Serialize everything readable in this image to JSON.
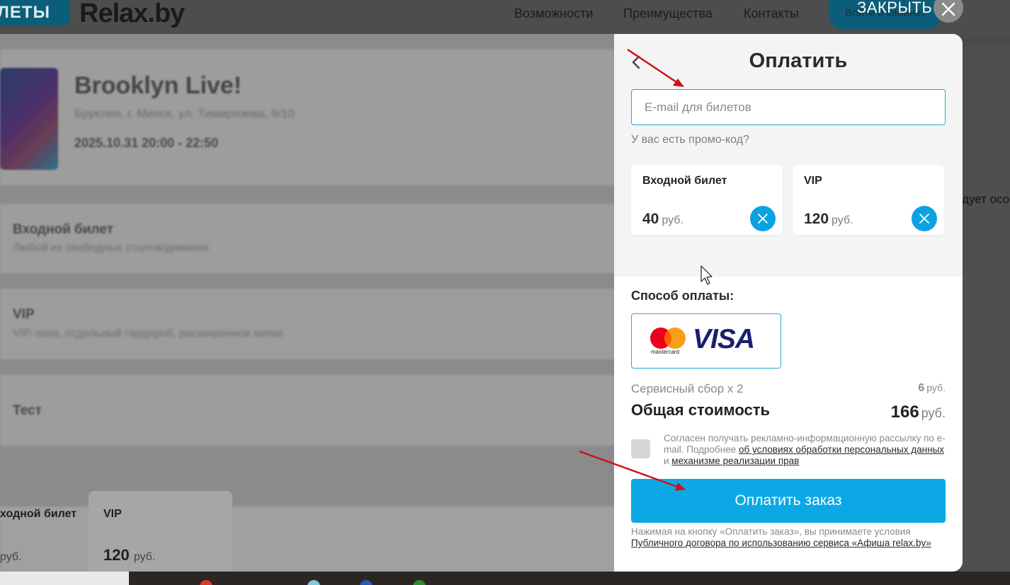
{
  "header": {
    "brand_badge": "ЛЕТЫ",
    "brand_logo": "Relax.by",
    "nav": [
      "Возможности",
      "Преимущества",
      "Контакты"
    ],
    "login_label": "Войти в кабинет",
    "close_label": "ЗАКРЫТЬ"
  },
  "background": {
    "event_title": "Brooklyn Live!",
    "event_address": "Бруклин, г. Минск, ул. Тимирязева, 9/10",
    "event_datetime": "2025.10.31 20:00 - 22:50",
    "rows": [
      {
        "title": "Входной билет",
        "desc": "Любой из свободных столов/диванов"
      },
      {
        "title": "VIP",
        "desc": "VIP-зона, отдельный гардероб, расширенное меню"
      },
      {
        "title": "Тест",
        "desc": ""
      }
    ],
    "bottom_tiles": [
      {
        "name": "ходной билет",
        "price": "",
        "currency": "руб."
      },
      {
        "name": "VIP",
        "price": "120",
        "currency": "руб."
      }
    ],
    "right_text": "дует осо"
  },
  "modal": {
    "title": "Оплатить",
    "email_placeholder": "E-mail для билетов",
    "promo_link": "У вас есть промо-код?",
    "tickets": [
      {
        "name": "Входной билет",
        "price": "40",
        "currency": "руб."
      },
      {
        "name": "VIP",
        "price": "120",
        "currency": "руб."
      }
    ],
    "payment_method_label": "Способ оплаты:",
    "payment_brands": {
      "mastercard": "mastercard",
      "visa": "VISA"
    },
    "service_fee_label": "Сервисный сбор x 2",
    "service_fee_amount": "6",
    "service_fee_currency": "руб.",
    "total_label": "Общая стоимость",
    "total_amount": "166",
    "total_currency": "руб.",
    "consent": {
      "text_before": "Согласен получать рекламно-информационную рассылку по e-mail. Подробнее ",
      "link1": "об условиях обработки персональных данных",
      "middle": " и ",
      "link2": "механизме реализации прав"
    },
    "pay_button": "Оплатить заказ",
    "terms": {
      "text": "Нажимая на кнопку «Оплатить заказ», вы принимаете условия ",
      "link": "Публичного договора по использованию сервиса «Афиша relax.by»"
    }
  },
  "colors": {
    "accent": "#0ca8e6",
    "input_border": "#2aa7d6",
    "annotation_arrow": "#d0101a",
    "visa_blue": "#1a1f71",
    "mastercard_red": "#eb001b",
    "mastercard_orange": "#f79e1b"
  },
  "icons": [
    "close-icon",
    "back-chevron-icon",
    "remove-ticket-icon",
    "mastercard-logo",
    "visa-logo",
    "mouse-cursor-icon",
    "annotation-arrow"
  ]
}
